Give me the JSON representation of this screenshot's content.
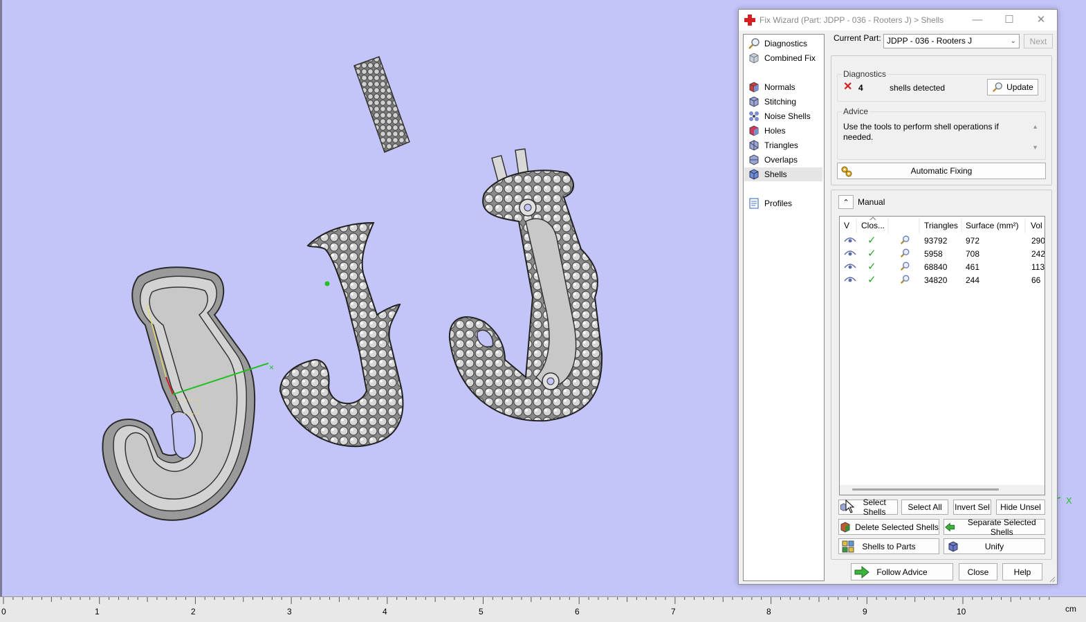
{
  "window": {
    "title": "Fix Wizard (Part: JDPP - 036 - Rooters J) > Shells",
    "minimize": "—",
    "maximize": "☐",
    "close": "✕"
  },
  "nav": {
    "items": [
      {
        "label": "Diagnostics"
      },
      {
        "label": "Combined Fix"
      },
      {
        "label": "Normals"
      },
      {
        "label": "Stitching"
      },
      {
        "label": "Noise Shells"
      },
      {
        "label": "Holes"
      },
      {
        "label": "Triangles"
      },
      {
        "label": "Overlaps"
      },
      {
        "label": "Shells"
      },
      {
        "label": "Profiles"
      }
    ],
    "selected": "Shells"
  },
  "current_part": {
    "label": "Current Part:",
    "value": "JDPP - 036 - Rooters J",
    "next_label": "Next"
  },
  "diagnostics": {
    "group_title": "Diagnostics",
    "count": "4",
    "text": "shells detected",
    "update_label": "Update"
  },
  "advice": {
    "group_title": "Advice",
    "text": "Use the tools to perform shell operations if needed."
  },
  "automatic_fixing_label": "Automatic Fixing",
  "manual": {
    "title": "Manual",
    "columns": [
      "V",
      "Clos...",
      "",
      "Triangles",
      "Surface (mm²)",
      "Vol"
    ],
    "rows": [
      {
        "triangles": "93792",
        "surface": "972",
        "volume": "290"
      },
      {
        "triangles": "5958",
        "surface": "708",
        "volume": "242"
      },
      {
        "triangles": "68840",
        "surface": "461",
        "volume": "113"
      },
      {
        "triangles": "34820",
        "surface": "244",
        "volume": "66"
      }
    ],
    "buttons": {
      "select_shells": "Select Shells",
      "select_all": "Select All",
      "invert_sel": "Invert Sel",
      "hide_unsel": "Hide Unsel",
      "delete_selected": "Delete Selected Shells",
      "separate_selected": "Separate Selected Shells",
      "shells_to_parts": "Shells to Parts",
      "unify": "Unify"
    }
  },
  "footer": {
    "follow_advice": "Follow Advice",
    "close": "Close",
    "help": "Help"
  },
  "ruler": {
    "labels": [
      "0",
      "1",
      "2",
      "3",
      "4",
      "5",
      "6",
      "7",
      "8",
      "9",
      "10"
    ],
    "unit": "cm"
  },
  "viewport": {
    "axis_label": "X",
    "background": "#c3c4f8"
  },
  "colors": {
    "accent_red": "#d42020",
    "check_green": "#2aa52a",
    "arrow_green": "#3cb43c"
  }
}
